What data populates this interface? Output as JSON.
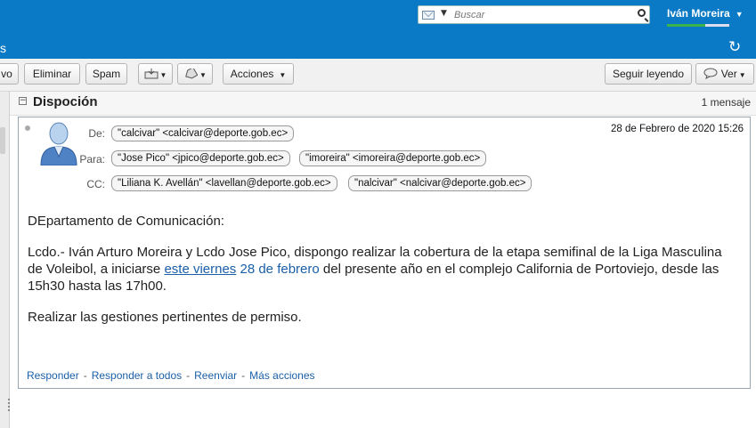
{
  "header": {
    "tab_partial": "s",
    "search_placeholder": "Buscar",
    "user_name": "Iván Moreira",
    "quota_fraction": 0.62,
    "brand_color": "#0a7ac6"
  },
  "toolbar": {
    "partial_label": "vo",
    "delete_label": "Eliminar",
    "spam_label": "Spam",
    "actions_label": "Acciones",
    "keep_reading_label": "Seguir leyendo",
    "view_label": "Ver"
  },
  "conversation": {
    "subject": "Dispoción",
    "count": "1 mensaje"
  },
  "message": {
    "from_label": "De:",
    "to_label": "Para:",
    "cc_label": "CC:",
    "from": "\"calcivar\" <calcivar@deporte.gob.ec>",
    "to": [
      "\"Jose Pico\" <jpico@deporte.gob.ec>",
      "\"imoreira\" <imoreira@deporte.gob.ec>"
    ],
    "cc": [
      "\"Liliana K. Avellán\" <lavellan@deporte.gob.ec>",
      "\"nalcivar\" <nalcivar@deporte.gob.ec>"
    ],
    "date": "28 de Febrero de 2020 15:26",
    "body": {
      "greeting": "DEpartamento de Comunicación:",
      "para1_a": "Lcdo.- Iván Arturo Moreira y Lcdo Jose Pico, dispongo realizar la cobertura de la etapa semifinal de la Liga Masculina de Voleibol, a iniciarse ",
      "para1_link1": "este viernes",
      "para1_space": " ",
      "para1_link2": "28 de febrero",
      "para1_b": " del presente año en el complejo California de Portoviejo, desde las 15h30 hasta las 17h00.",
      "para2": "Realizar las gestiones pertinentes de permiso."
    },
    "actions": {
      "reply": "Responder",
      "reply_all": "Responder a todos",
      "forward": "Reenviar",
      "more": "Más acciones",
      "separator": "-"
    }
  }
}
